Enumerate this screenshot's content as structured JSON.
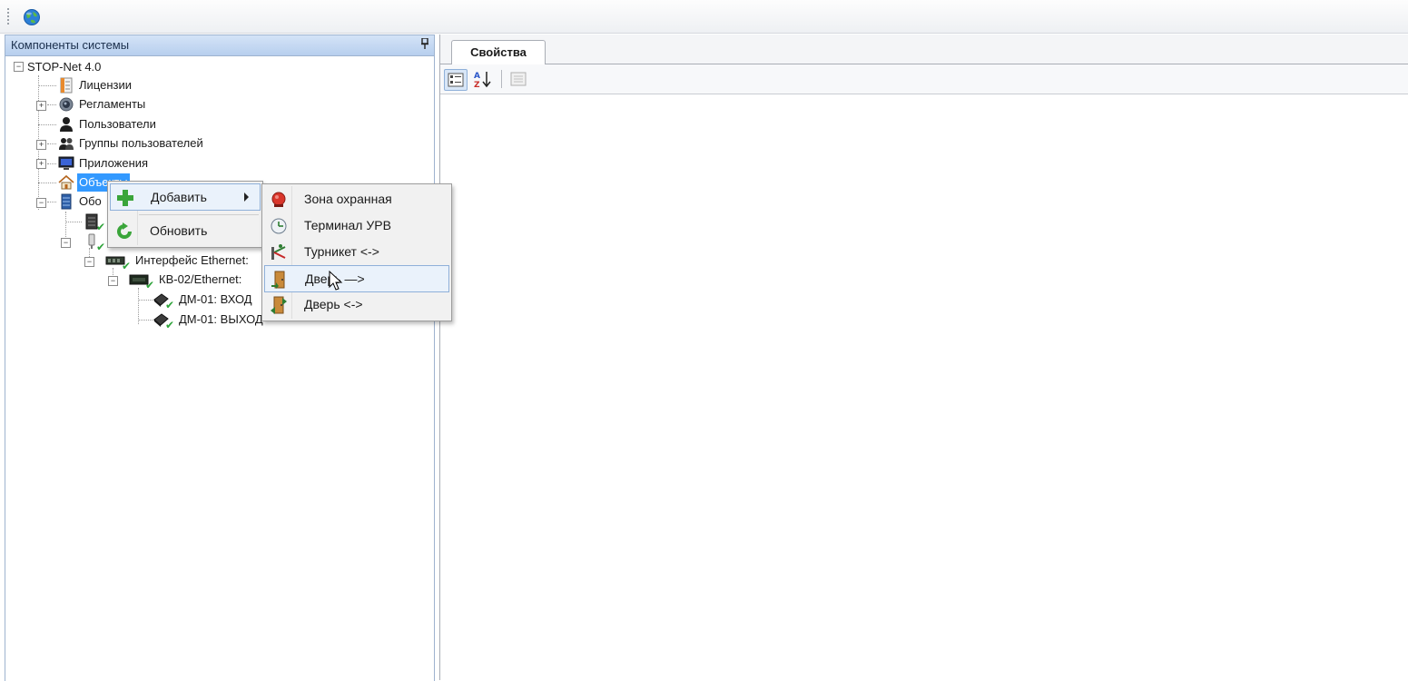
{
  "left_panel": {
    "title": "Компоненты системы",
    "pin_glyph": "📌"
  },
  "tree": {
    "root": "STOP-Net 4.0",
    "items": [
      {
        "label": "Лицензии",
        "icon": "license-icon"
      },
      {
        "label": "Регламенты",
        "icon": "schedule-icon"
      },
      {
        "label": "Пользователи",
        "icon": "user-icon"
      },
      {
        "label": "Группы пользователей",
        "icon": "users-icon"
      },
      {
        "label": "Приложения",
        "icon": "monitor-icon"
      },
      {
        "label": "Объекты",
        "icon": "house-icon"
      },
      {
        "label": "Обо",
        "icon": "equipment-icon"
      },
      {
        "label": "Интерфейс Ethernet:",
        "icon": "network-card-icon"
      },
      {
        "label": "КВ-02/Ethernet:",
        "icon": "controller-icon"
      },
      {
        "label": "ДМ-01: ВХОД",
        "icon": "module-icon"
      },
      {
        "label": "ДМ-01: ВЫХОД",
        "icon": "module-icon"
      }
    ]
  },
  "right_panel": {
    "tab_label": "Свойства"
  },
  "context_menu": {
    "items": [
      {
        "label": "Добавить",
        "icon": "plus-icon"
      },
      {
        "label": "Обновить",
        "icon": "refresh-icon"
      }
    ]
  },
  "submenu": {
    "items": [
      {
        "label": "Зона охранная",
        "icon": "alarm-icon"
      },
      {
        "label": "Терминал УРВ",
        "icon": "clock-icon"
      },
      {
        "label": "Турникет <->",
        "icon": "turnstile-icon"
      },
      {
        "label": "Дверь —>",
        "icon": "door-icon"
      },
      {
        "label": "Дверь <->",
        "icon": "door-both-icon"
      }
    ]
  },
  "colors": {
    "selection": "#3399ff",
    "pane_header": "#c6d9f3",
    "check_green": "#2ea33a"
  }
}
